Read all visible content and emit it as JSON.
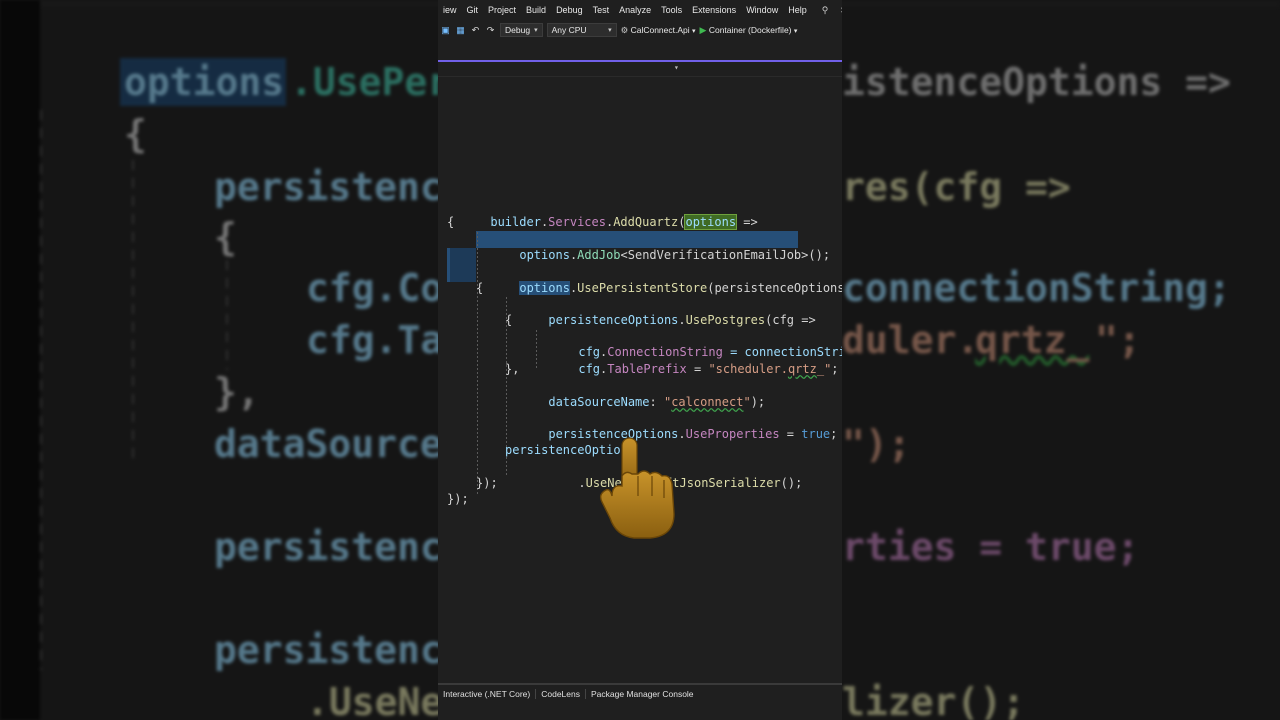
{
  "menu": {
    "items": [
      "iew",
      "Git",
      "Project",
      "Build",
      "Debug",
      "Test",
      "Analyze",
      "Tools",
      "Extensions",
      "Window",
      "Help"
    ],
    "search_label": "Se"
  },
  "toolbar": {
    "config": "Debug",
    "platform": "Any CPU",
    "project": "CalConnect.Api",
    "run_target": "Container (Dockerfile)"
  },
  "code": {
    "l1": {
      "a": "builder",
      "b": ".",
      "c": "Services",
      "d": ".",
      "e": "AddQuartz",
      "f": "(",
      "g": "options",
      "h": " =>"
    },
    "l2": "{",
    "l3": {
      "a": "options",
      "b": ".",
      "c": "AddJob",
      "d": "<SendVerificationEmailJob>();"
    },
    "l4": {
      "a": "options",
      "b": ".",
      "c": "UsePersistentStore",
      "d": "(persistenceOptions =>"
    },
    "l5": "{",
    "l6": {
      "a": "persistenceOptions",
      "b": ".",
      "c": "UsePostgres",
      "d": "(cfg =>"
    },
    "l7": "{",
    "l8": {
      "a": "cfg",
      "b": ".",
      "c": "ConnectionString",
      "d": " = connectionString;"
    },
    "l9": {
      "a": "cfg",
      "b": ".",
      "c": "TablePrefix",
      "d": " = ",
      "e": "\"scheduler.",
      "f": "qrtz",
      "g": "_\"",
      "h": ";"
    },
    "l10": "},",
    "l11": {
      "a": "dataSourceName",
      "b": ": ",
      "c": "\"",
      "d": "calconnect",
      "e": "\"",
      "f": ");"
    },
    "l12": {
      "a": "persistenceOptions",
      "b": ".",
      "c": "UseProperties",
      "d": " = ",
      "e": "true",
      "f": ";"
    },
    "l13": "persistenceOptions",
    "l14": {
      "a": ".",
      "b": "UseNewtonsoftJsonSerializer",
      "c": "();"
    },
    "l15": "});",
    "l16": "});"
  },
  "background_text": {
    "b1a": "options",
    "b1b": ".UsePer",
    "b1c": "istenceOptions =>",
    "b2": "{",
    "b3a": "persistenc",
    "b3b": "res(cfg =>",
    "b4": "{",
    "b5a": "cfg.Co",
    "b5b": "connectionString;",
    "b6a": "cfg.Ta",
    "b6b": "duler.",
    "b6c": "qrtz_",
    "b6d": "\";",
    "b7": "},",
    "b8a": "dataSource",
    "b8b": "\");",
    "b9a": "persistenc",
    "b9b": "rties = true;",
    "b10a": "persistenc",
    "b11a": ".UseNe",
    "b11b": "lizer();"
  },
  "statusbar": {
    "items": [
      "Interactive (.NET Core)",
      "CodeLens",
      "Package Manager Console"
    ]
  },
  "colors": {
    "accent": "#7160e8",
    "selection": "#264f78",
    "editor_bg": "#1f1f1f"
  },
  "icons": [
    "undo-icon",
    "redo-icon",
    "save-icon",
    "save-all-icon",
    "run-icon",
    "search-icon",
    "pointing-hand-cursor"
  ]
}
